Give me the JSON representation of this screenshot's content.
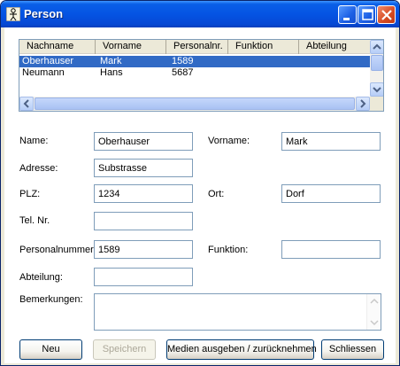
{
  "window": {
    "title": "Person"
  },
  "list": {
    "columns": [
      "Nachname",
      "Vorname",
      "Personalnr.",
      "Funktion",
      "Abteilung"
    ],
    "rows": [
      {
        "nachname": "Oberhauser",
        "vorname": "Mark",
        "personalnr": "1589",
        "funktion": "",
        "abteilung": "",
        "selected": true
      },
      {
        "nachname": "Neumann",
        "vorname": "Hans",
        "personalnr": "5687",
        "funktion": "",
        "abteilung": "",
        "selected": false
      }
    ]
  },
  "form": {
    "name_label": "Name:",
    "name_value": "Oberhauser",
    "vorname_label": "Vorname:",
    "vorname_value": "Mark",
    "adresse_label": "Adresse:",
    "adresse_value": "Substrasse",
    "plz_label": "PLZ:",
    "plz_value": "1234",
    "ort_label": "Ort:",
    "ort_value": "Dorf",
    "tel_label": "Tel. Nr.",
    "tel_value": "",
    "personalnummer_label": "Personalnummer:",
    "personalnummer_value": "1589",
    "funktion_label": "Funktion:",
    "funktion_value": "",
    "abteilung_label": "Abteilung:",
    "abteilung_value": "",
    "bemerkungen_label": "Bemerkungen:",
    "bemerkungen_value": ""
  },
  "buttons": {
    "neu": "Neu",
    "speichern": "Speichern",
    "medien": "Medien ausgeben / zurücknehmen",
    "schliessen": "Schliessen"
  }
}
